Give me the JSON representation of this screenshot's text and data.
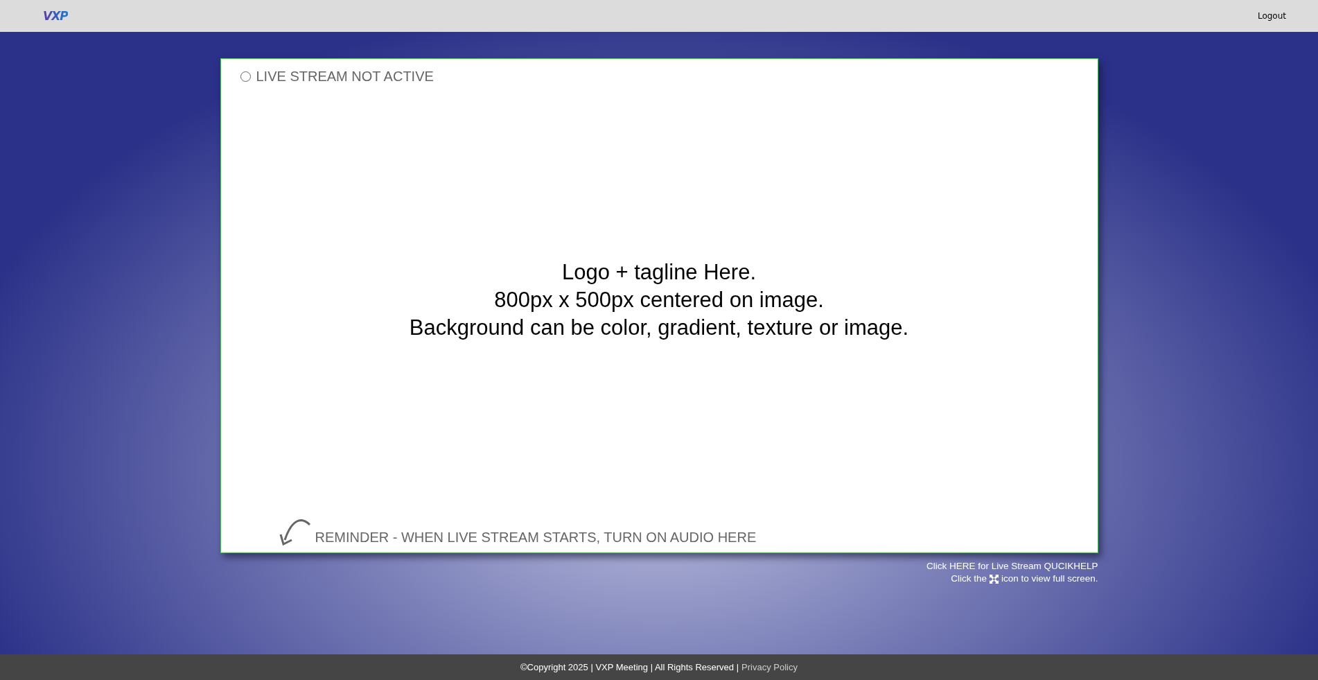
{
  "header": {
    "logo": "VXP",
    "logout": "Logout"
  },
  "player": {
    "status": {
      "live": false,
      "label": "LIVE STREAM NOT ACTIVE"
    },
    "placeholder_lines": [
      "Logo + tagline Here.",
      "800px x 500px centered on image.",
      "Background can be color, gradient, texture or image."
    ],
    "reminder": "REMINDER - WHEN LIVE STREAM STARTS, TURN ON AUDIO HERE"
  },
  "help": {
    "quickhelp": "Click HERE for Live Stream QUCIKHELP",
    "fullscreen_before": "Click the",
    "fullscreen_after": "icon to view full screen."
  },
  "footer": {
    "text": "©Copyright 2025 | VXP Meeting | All Rights Reserved |",
    "link": "Privacy Policy"
  }
}
